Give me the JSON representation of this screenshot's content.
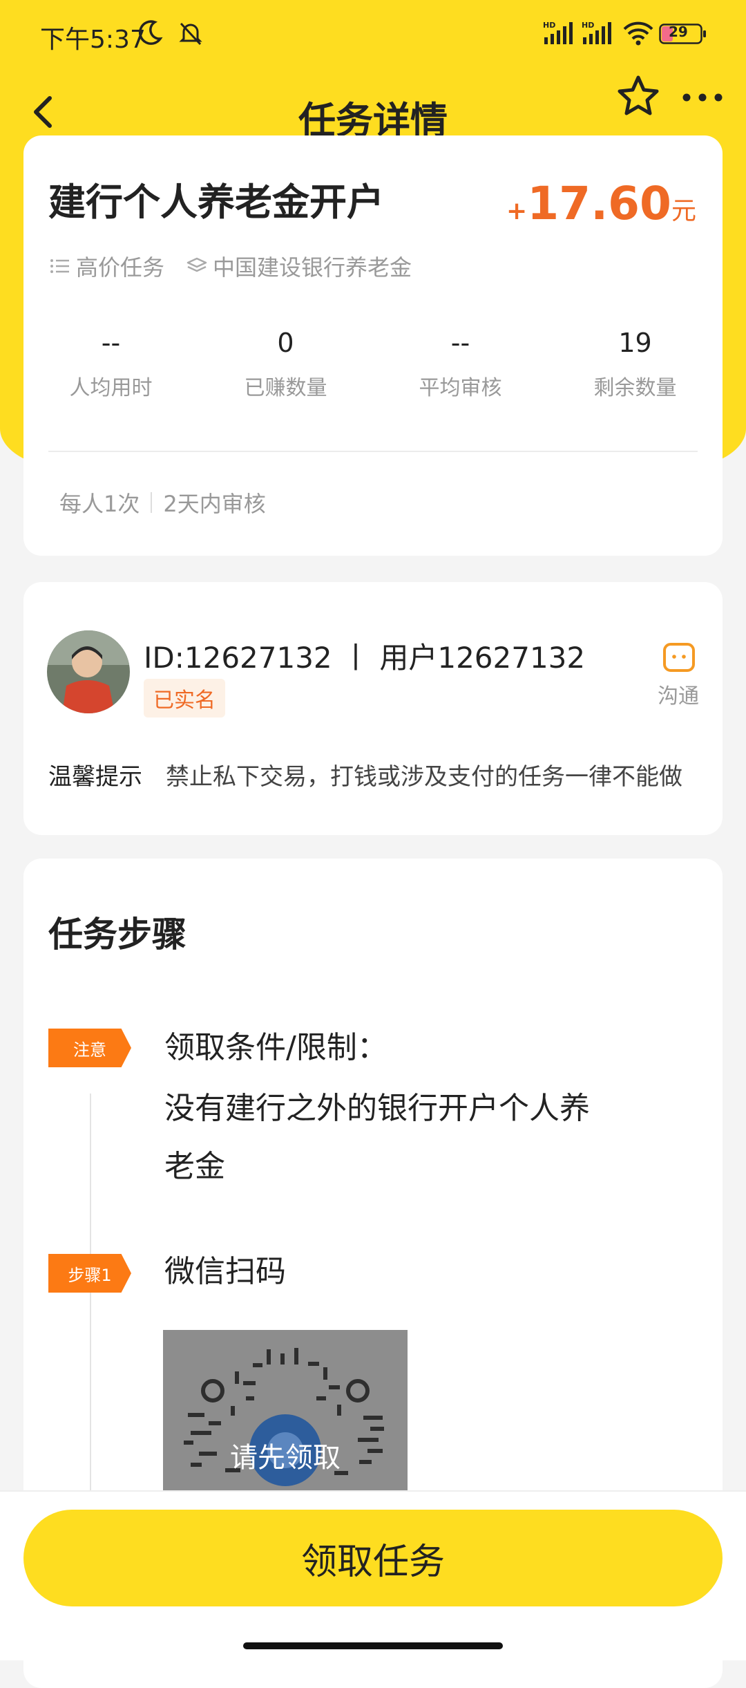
{
  "status_bar": {
    "time": "下午5:37",
    "battery": "29"
  },
  "nav": {
    "title": "任务详情"
  },
  "task": {
    "title": "建行个人养老金开户",
    "reward_plus": "+",
    "reward_amount": "17.60",
    "reward_unit": "元",
    "tags": [
      "高价任务",
      "中国建设银行养老金"
    ],
    "stats": [
      {
        "value": "--",
        "label": "人均用时"
      },
      {
        "value": "0",
        "label": "已赚数量"
      },
      {
        "value": "--",
        "label": "平均审核"
      },
      {
        "value": "19",
        "label": "剩余数量"
      }
    ],
    "limits": [
      "每人1次",
      "2天内审核"
    ]
  },
  "publisher": {
    "id_line": "ID:12627132 丨 用户12627132",
    "verified": "已实名",
    "chat_label": "沟通",
    "tip_label": "温馨提示",
    "tip_text": "禁止私下交易，打钱或涉及支付的任务一律不能做"
  },
  "steps": {
    "title": "任务步骤",
    "items": [
      {
        "badge": "注意",
        "lines": [
          "领取条件/限制：",
          "没有建行之外的银行开户个人养",
          "老金"
        ]
      },
      {
        "badge": "步骤1",
        "lines": [
          "微信扫码"
        ]
      }
    ],
    "qr_overlay": "请先领取"
  },
  "bottom": {
    "button_label": "领取任务"
  },
  "colors": {
    "brand_yellow": "#fedd20",
    "accent_orange": "#ef6a25",
    "badge_orange": "#fc7a14"
  }
}
